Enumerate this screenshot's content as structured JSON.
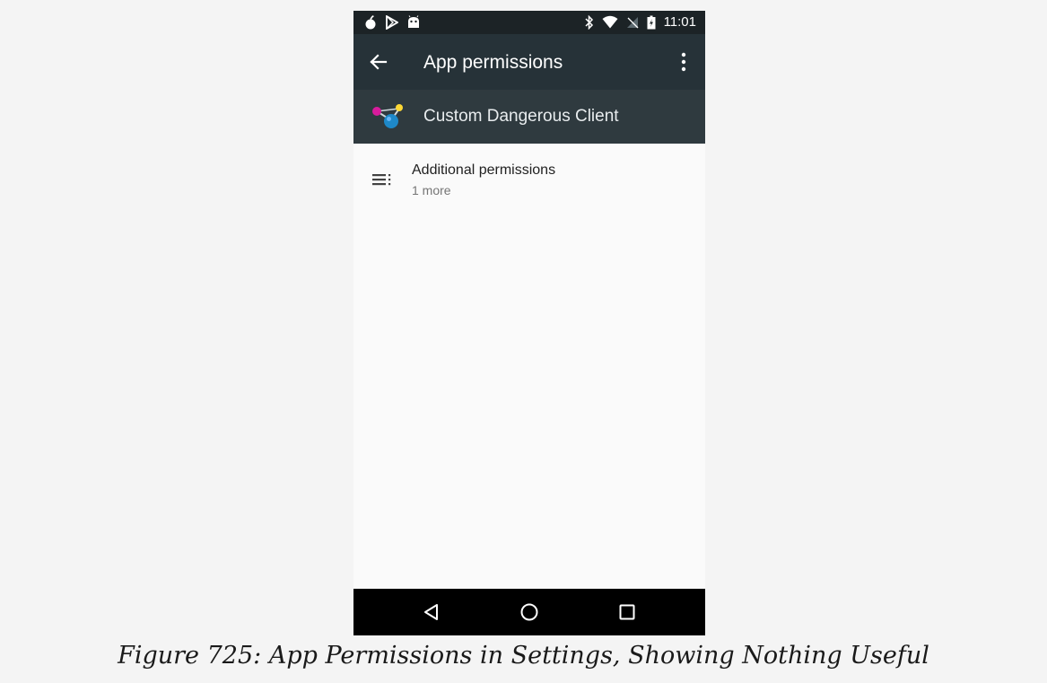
{
  "status_bar": {
    "time": "11:01",
    "left_icons": [
      "bomb-icon",
      "play-store-icon",
      "android-icon"
    ],
    "right_icons": [
      "bluetooth-icon",
      "wifi-icon",
      "no-signal-icon",
      "battery-charging-icon"
    ]
  },
  "toolbar": {
    "title": "App permissions",
    "back_icon": "arrow-back-icon",
    "overflow_icon": "more-vert-icon"
  },
  "app_header": {
    "app_name": "Custom Dangerous Client",
    "app_icon": "molecule-app-icon"
  },
  "permissions_list": [
    {
      "icon": "list-icon",
      "title": "Additional permissions",
      "subtitle": "1 more"
    }
  ],
  "nav_bar": {
    "icons": [
      "nav-back-icon",
      "nav-home-icon",
      "nav-recents-icon"
    ]
  },
  "caption": "Figure 725: App Permissions in Settings, Showing Nothing Useful",
  "colors": {
    "status_bar_bg": "#1c2326",
    "toolbar_bg": "#263238",
    "app_header_bg": "#2f3a3f",
    "content_bg": "#fafafa",
    "nav_bar_bg": "#000000"
  }
}
